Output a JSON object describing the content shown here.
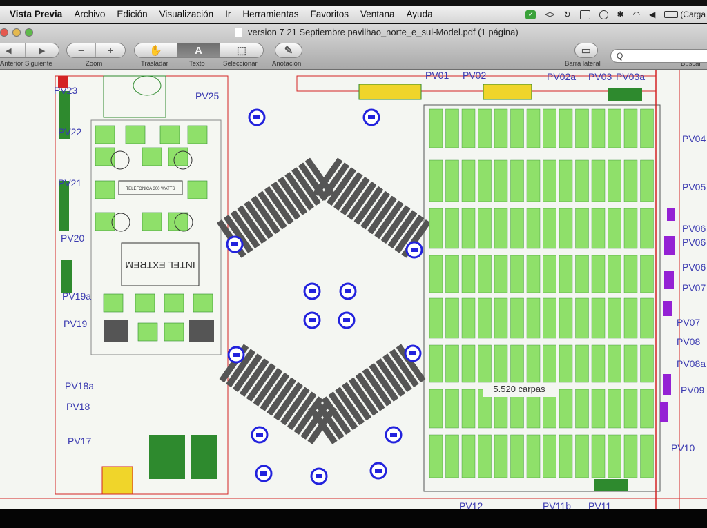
{
  "menubar": {
    "app": "Vista Previa",
    "items": [
      "Archivo",
      "Edición",
      "Visualización",
      "Ir",
      "Herramientas",
      "Favoritos",
      "Ventana",
      "Ayuda"
    ],
    "status_battery": "(Carga"
  },
  "window": {
    "title": "version 7 21 Septiembre pavilhao_norte_e_sul-Model.pdf (1 página)"
  },
  "toolbar": {
    "prev_label": "Anterior",
    "next_label": "Siguiente",
    "zoom_label": "Zoom",
    "zoom_minus": "−",
    "zoom_plus": "+",
    "move_label": "Trasladar",
    "text_label": "Texto",
    "text_glyph": "A",
    "select_label": "Seleccionar",
    "annotate_label": "Anotación",
    "sidebar_label": "Barra lateral",
    "search_label": "Buscar",
    "search_value": "Q"
  },
  "plan": {
    "left_labels": [
      "PV23",
      "PV25",
      "PV22",
      "PV21",
      "PV20",
      "PV19a",
      "PV19",
      "PV18a",
      "PV18",
      "PV17"
    ],
    "top_labels": [
      "PV01",
      "PV02",
      "PV02a",
      "PV03",
      "PV03a"
    ],
    "right_labels": [
      "PV04",
      "PV05",
      "PV06",
      "PV06",
      "PV06",
      "PV07",
      "PV07",
      "PV08",
      "PV08a",
      "PV09",
      "PV10"
    ],
    "bottom_labels": [
      "PV12",
      "PV11b",
      "PV11"
    ],
    "booth_telefonica": "TELEFONICA 300 WATTS",
    "booth_intel": "INTEL EXTREM",
    "capacity_label": "5.520  carpas",
    "colors": {
      "green": "#8fe06a",
      "darkgreen": "#2e8a2e",
      "seat": "#555555",
      "blue": "#2222dd",
      "red": "#d42424",
      "yellow": "#f0d52a",
      "purple": "#9422d4"
    }
  }
}
